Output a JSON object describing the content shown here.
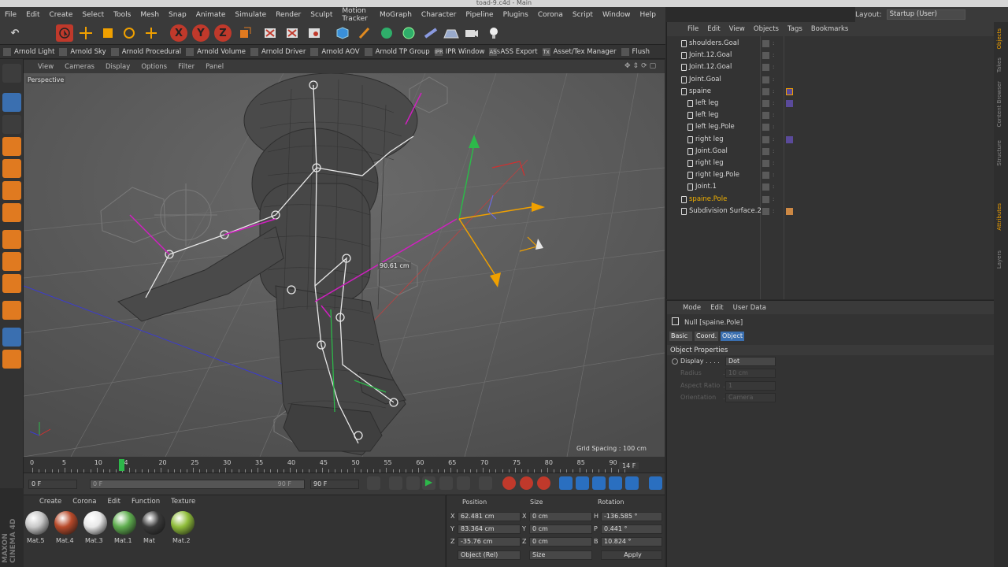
{
  "window": {
    "title": "toad-9.c4d - Main"
  },
  "menu": [
    "File",
    "Edit",
    "Create",
    "Select",
    "Tools",
    "Mesh",
    "Snap",
    "Animate",
    "Simulate",
    "Render",
    "Sculpt",
    "Motion Tracker",
    "MoGraph",
    "Character",
    "Pipeline",
    "Plugins",
    "Corona",
    "Script",
    "Window",
    "Help"
  ],
  "layout": {
    "label": "Layout:",
    "value": "Startup (User)"
  },
  "toolbar": {
    "x": "X",
    "y": "Y",
    "z": "Z"
  },
  "arnold": [
    "Arnold Light",
    "Arnold Sky",
    "Arnold Procedural",
    "Arnold Volume",
    "Arnold Driver",
    "Arnold AOV",
    "Arnold TP Group",
    "IPR Window",
    "ASS Export",
    "Asset/Tex Manager",
    "Flush"
  ],
  "arnold_icons": [
    "",
    "",
    "",
    "",
    "",
    "",
    "",
    "IPR",
    "ASS",
    "Tx",
    ""
  ],
  "viewport": {
    "menu": [
      "View",
      "Cameras",
      "Display",
      "Options",
      "Filter",
      "Panel"
    ],
    "label": "Perspective",
    "grid_spacing": "Grid Spacing : 100 cm",
    "measure": "90.61 cm"
  },
  "timeline": {
    "ticks": [
      "0",
      "5",
      "10",
      "14",
      "20",
      "25",
      "30",
      "35",
      "40",
      "45",
      "50",
      "55",
      "60",
      "65",
      "70",
      "75",
      "80",
      "85",
      "90"
    ],
    "current": "14 F",
    "current_frame": 14
  },
  "anim": {
    "start": "0 F",
    "min": "0 F",
    "max": "90 F",
    "end": "90 F"
  },
  "materials": {
    "menu": [
      "Create",
      "Corona",
      "Edit",
      "Function",
      "Texture"
    ],
    "items": [
      {
        "name": "Mat.5",
        "color": "#c8c8c8"
      },
      {
        "name": "Mat.4",
        "color": "#b84a2a"
      },
      {
        "name": "Mat.3",
        "color": "#e8e8e8"
      },
      {
        "name": "Mat.1",
        "color": "#5fae4f"
      },
      {
        "name": "Mat",
        "color": "#3a3a3a"
      },
      {
        "name": "Mat.2",
        "color": "#8fbd3a"
      }
    ]
  },
  "coords": {
    "headers": {
      "position": "Position",
      "size": "Size",
      "rotation": "Rotation"
    },
    "rows": [
      {
        "axis": "X",
        "pos": "62.481 cm",
        "saxis": "X",
        "size": "0 cm",
        "raxis": "H",
        "rot": "-136.585 °"
      },
      {
        "axis": "Y",
        "pos": "83.364 cm",
        "saxis": "Y",
        "size": "0 cm",
        "raxis": "P",
        "rot": "0.441 °"
      },
      {
        "axis": "Z",
        "pos": "-35.76 cm",
        "saxis": "Z",
        "size": "0 cm",
        "raxis": "B",
        "rot": "10.824 °"
      }
    ],
    "mode": "Object (Rel)",
    "size_mode": "Size",
    "apply": "Apply"
  },
  "objects": {
    "menu": [
      "File",
      "Edit",
      "View",
      "Objects",
      "Tags",
      "Bookmarks"
    ],
    "rows": [
      {
        "name": "shoulders.Goal",
        "indent": 0,
        "color": "#d5d5d5"
      },
      {
        "name": "Joint.12.Goal",
        "indent": 0,
        "color": "#d5d5d5"
      },
      {
        "name": "Joint.12.Goal",
        "indent": 0,
        "color": "#d5d5d5"
      },
      {
        "name": "Joint.Goal",
        "indent": 0,
        "color": "#d5d5d5"
      },
      {
        "name": "spaine",
        "indent": 0,
        "color": "#d5d5d5"
      },
      {
        "name": "left leg",
        "indent": 1,
        "color": "#d5d5d5"
      },
      {
        "name": "left leg",
        "indent": 1,
        "color": "#d5d5d5"
      },
      {
        "name": "left leg.Pole",
        "indent": 1,
        "color": "#d5d5d5"
      },
      {
        "name": "right leg",
        "indent": 1,
        "color": "#d5d5d5"
      },
      {
        "name": "Joint.Goal",
        "indent": 1,
        "color": "#d5d5d5"
      },
      {
        "name": "right leg",
        "indent": 1,
        "color": "#d5d5d5"
      },
      {
        "name": "right leg.Pole",
        "indent": 1,
        "color": "#d5d5d5"
      },
      {
        "name": "Joint.1",
        "indent": 1,
        "color": "#d5d5d5"
      },
      {
        "name": "spaine.Pole",
        "indent": 0,
        "color": "#f0b000"
      },
      {
        "name": "Subdivision Surface.2",
        "indent": 0,
        "color": "#d5d5d5"
      }
    ]
  },
  "attributes": {
    "menu": [
      "Mode",
      "Edit",
      "User Data"
    ],
    "object": "Null [spaine.Pole]",
    "tabs": [
      "Basic",
      "Coord.",
      "Object"
    ],
    "section": "Object Properties",
    "props": [
      {
        "label": "Display",
        "value": "Dot",
        "enabled": true
      },
      {
        "label": "Radius",
        "value": "10 cm",
        "enabled": false
      },
      {
        "label": "Aspect Ratio",
        "value": "1",
        "enabled": false
      },
      {
        "label": "Orientation",
        "value": "Camera",
        "enabled": false
      }
    ]
  },
  "side_tabs": [
    "Objects",
    "Takes",
    "Content Browser",
    "Structure",
    "Attributes",
    "Layers"
  ],
  "brand": "MAXON CINEMA 4D"
}
